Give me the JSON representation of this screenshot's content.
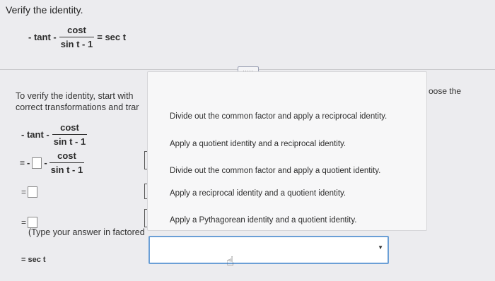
{
  "header": {
    "title": "Verify the identity."
  },
  "problem": {
    "lhs_prefix": "- tant -",
    "numerator": "cost",
    "denominator": "sin t - 1",
    "rhs": "= sec t"
  },
  "expand_button": {
    "label": "....."
  },
  "instruction": {
    "line1": "To verify the identity, start with",
    "line2": "correct transformations and trar"
  },
  "choose_fragment": "oose the",
  "work": {
    "lhs_prefix": "- tant -",
    "numerator": "cost",
    "denominator": "sin t - 1",
    "row2_prefix": "=",
    "row2_minus1": "-",
    "row2_minus2": "-",
    "row2_numerator": "cost",
    "row2_denominator": "sin t - 1",
    "row3_prefix": "=",
    "row4_prefix": "="
  },
  "type_note": "(Type your answer in factored",
  "final_eq": "= sec t",
  "dropdown": {
    "options": [
      "Divide out the common factor and apply a reciprocal identity.",
      "Apply a quotient identity and a reciprocal identity.",
      "Divide out the common factor and apply a quotient identity.",
      "Apply a reciprocal identity and a quotient identity.",
      "Apply a Pythagorean identity and a quotient identity."
    ],
    "arrow": "▼",
    "selected": ""
  },
  "colors": {
    "accent": "#6b9fd6",
    "background": "#ececef",
    "menu_bg": "#f7f7f8"
  },
  "icons": {
    "cursor": "hand-pointer-icon",
    "dropdown": "caret-down-icon"
  }
}
